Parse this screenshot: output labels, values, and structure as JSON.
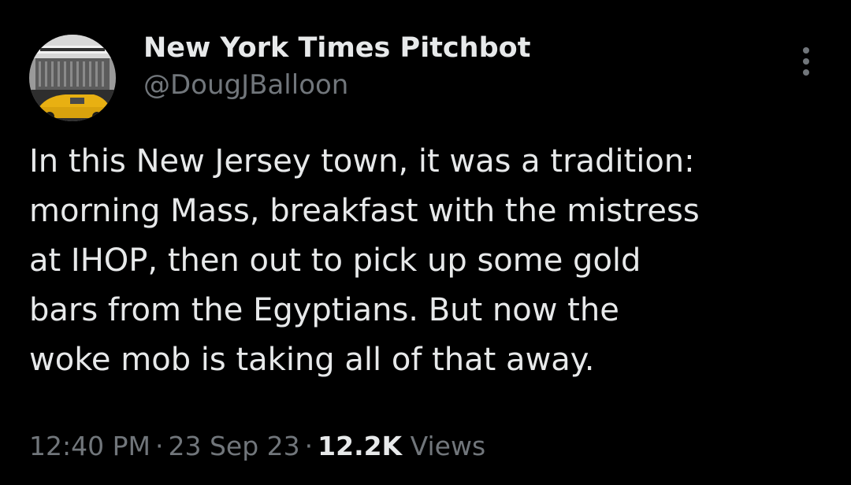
{
  "author": {
    "display_name": "New York Times Pitchbot",
    "handle": "@DougJBalloon",
    "avatar_icon": "nyt-building-taxi-avatar"
  },
  "menu": {
    "more_icon": "more-options-icon"
  },
  "tweet": {
    "text": "In this New Jersey town, it was a tradition:\nmorning Mass, breakfast with the mistress\nat IHOP, then out to pick up some gold\nbars from the Egyptians.  But now the\nwoke mob is taking all of that away."
  },
  "meta": {
    "time": "12:40 PM",
    "separator": "·",
    "date": "23 Sep 23",
    "views_count": "12.2K",
    "views_label": "Views"
  },
  "colors": {
    "background": "#000000",
    "primary_text": "#e7e9ea",
    "secondary_text": "#71767b"
  }
}
